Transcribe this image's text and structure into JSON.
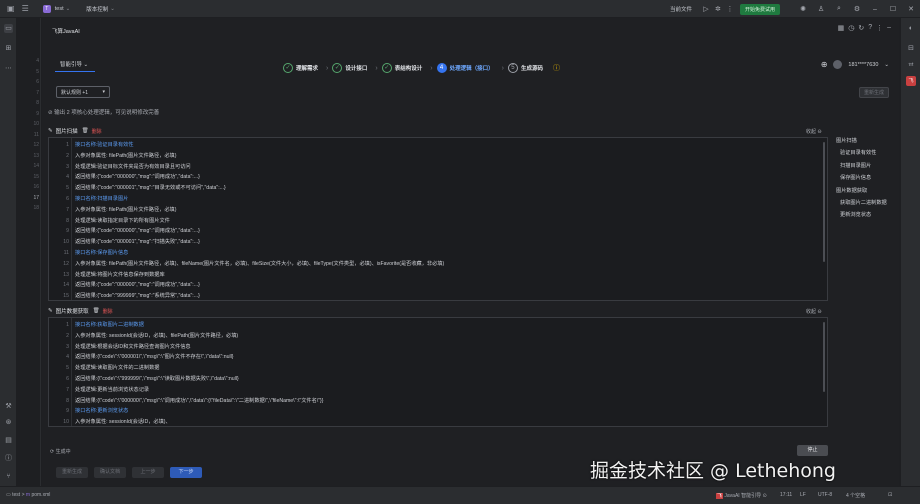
{
  "titlebar": {
    "project": "test",
    "project_initial": "T",
    "vcs": "版本控制",
    "current_file": "当前文件",
    "run_button": "开始免费试用"
  },
  "panel": {
    "plugin_title": "飞算JavaAI",
    "mode_tab": "智能引导",
    "user_name": "181****7630"
  },
  "stepper": {
    "steps": [
      {
        "num": "✓",
        "label": "理解需求",
        "state": "done"
      },
      {
        "num": "✓",
        "label": "设计接口",
        "state": "done"
      },
      {
        "num": "✓",
        "label": "表结构设计",
        "state": "done"
      },
      {
        "num": "4",
        "label": "处理逻辑（接口）",
        "state": "active"
      },
      {
        "num": "5",
        "label": "生成源码",
        "state": "todo"
      }
    ]
  },
  "controls": {
    "select_value": "默认规则 +1",
    "regen_button": "重新生成",
    "info_text": "输出 2 项核心处理逻辑，可见说明修改完善"
  },
  "section1": {
    "title": "图片扫描",
    "delete": "删除",
    "collapse": "收起",
    "lines": [
      {
        "n": "1",
        "t": "接口名称:验证目录有效性",
        "h": true
      },
      {
        "n": "2",
        "t": "入参对象属性: filePath(图片文件路径，必填)",
        "h": false
      },
      {
        "n": "3",
        "t": "处理逻辑:验证目标文件夹是否为有效目录且可访问",
        "h": false
      },
      {
        "n": "4",
        "t": "返回结果:{\"code\":\"000000\",\"msg\":\"调用成功\",\"data\":...}",
        "h": false
      },
      {
        "n": "5",
        "t": "返回结果:{\"code\":\"000001\",\"msg\":\"目录无效或不可访问\",\"data\":...}",
        "h": false
      },
      {
        "n": "6",
        "t": "接口名称:扫描目录图片",
        "h": true
      },
      {
        "n": "7",
        "t": "入参对象属性: filePath(图片文件路径，必填)",
        "h": false
      },
      {
        "n": "8",
        "t": "处理逻辑:读取指定目录下的所有图片文件",
        "h": false
      },
      {
        "n": "9",
        "t": "返回结果:{\"code\":\"000000\",\"msg\":\"调用成功\",\"data\":...}",
        "h": false
      },
      {
        "n": "10",
        "t": "返回结果:{\"code\":\"000001\",\"msg\":\"扫描失败\",\"data\":...}",
        "h": false
      },
      {
        "n": "11",
        "t": "接口名称:保存图片信息",
        "h": true
      },
      {
        "n": "12",
        "t": "入参对象属性: filePath(图片文件路径，必填)、fileName(图片文件名，必填)、fileSize(文件大小，必填)、fileType(文件类型，必填)、isFavorite(是否收藏，非必填)",
        "h": false
      },
      {
        "n": "13",
        "t": "处理逻辑:将图片文件信息保存到数据库",
        "h": false
      },
      {
        "n": "14",
        "t": "返回结果:{\"code\":\"000000\",\"msg\":\"调用成功\",\"data\":...}",
        "h": false
      },
      {
        "n": "15",
        "t": "返回结果:{\"code\":\"999999\",\"msg\":\"系统异常\",\"data\":...}",
        "h": false
      }
    ]
  },
  "section2": {
    "title": "图片数据获取",
    "delete": "删除",
    "collapse": "收起",
    "lines": [
      {
        "n": "1",
        "t": "接口名称:获取图片二进制数据",
        "h": true
      },
      {
        "n": "2",
        "t": "入参对象属性: sessionId(会话ID，必填)、filePath(图片文件路径，必填)",
        "h": false
      },
      {
        "n": "3",
        "t": "处理逻辑:根据会话ID和文件路径查询图片文件信息",
        "h": false
      },
      {
        "n": "4",
        "t": "返回结果:{\\\"code\\\":\\\"000001\\\",\\\"msg\\\":\\\"图片文件不存在\\\",\\\"data\\\":null}",
        "h": false
      },
      {
        "n": "5",
        "t": "处理逻辑:读取图片文件的二进制数据",
        "h": false
      },
      {
        "n": "6",
        "t": "返回结果:{\\\"code\\\":\\\"999999\\\",\\\"msg\\\":\\\"读取图片数据失败\\\",\\\"data\\\":null}",
        "h": false
      },
      {
        "n": "7",
        "t": "处理逻辑:更新当前浏览状态记录",
        "h": false
      },
      {
        "n": "8",
        "t": "返回结果:{\\\"code\\\":\\\"000000\\\",\\\"msg\\\":\\\"调用成功\\\",\\\"data\\\":{\\\"fileData\\\":\\\"二进制数据\\\",\\\"fileName\\\":\\\"文件名\\\"}}",
        "h": false
      },
      {
        "n": "9",
        "t": "接口名称:更新浏览状态",
        "h": true
      },
      {
        "n": "10",
        "t": "入参对象属性: sessionId(会话ID，必填)、",
        "h": false
      }
    ]
  },
  "outline": {
    "items": [
      {
        "t": "图片扫描",
        "lvl": 0
      },
      {
        "t": "验证目录有效性",
        "lvl": 1
      },
      {
        "t": "扫描目录图片",
        "lvl": 1
      },
      {
        "t": "保存图片信息",
        "lvl": 1
      },
      {
        "t": "图片数据获取",
        "lvl": 0
      },
      {
        "t": "获取图片二进制数据",
        "lvl": 1
      },
      {
        "t": "更新浏览状态",
        "lvl": 1
      }
    ]
  },
  "footer": {
    "status": "生成中",
    "stop": "停止",
    "btn_regen": "重新生成",
    "btn_confirm": "确认文档",
    "btn_prev": "上一步",
    "btn_next": "下一步"
  },
  "statusbar": {
    "crumb1": "test",
    "crumb2": "pom.xml",
    "plugin": "JavaAI",
    "plugin_status": "智能引导",
    "pos": "17:11",
    "eol": "LF",
    "enc": "UTF-8",
    "indent": "4 个空格"
  },
  "editor_lines": [
    "4",
    "5",
    "6",
    "7",
    "8",
    "9",
    "10",
    "11",
    "12",
    "13",
    "14",
    "15",
    "16",
    "17",
    "18"
  ],
  "watermark": "掘金技术社区 @ Lethehong",
  "colors": {
    "accent": "#3574f0",
    "done": "#56a86e",
    "danger": "#e05555",
    "run": "#1f7a3f"
  }
}
